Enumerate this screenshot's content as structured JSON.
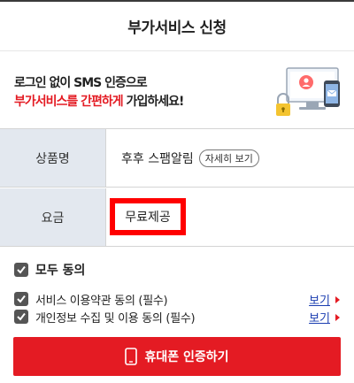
{
  "header": {
    "title": "부가서비스 신청"
  },
  "promo": {
    "line1": "로그인 없이 SMS 인증으로",
    "line2_highlight": "부가서비스를 간편하게",
    "line2_rest": " 가입하세요!",
    "illustration_icon": "computer-phone-lock-icon"
  },
  "info": {
    "rows": [
      {
        "label": "상품명",
        "value": "후후 스팸알림",
        "detail_button": "자세히 보기"
      },
      {
        "label": "요금",
        "value": "무료제공"
      }
    ]
  },
  "agreements": {
    "all_label": "모두 동의",
    "items": [
      {
        "label": "서비스 이용약관 동의 (필수)",
        "view_label": "보기"
      },
      {
        "label": "개인정보 수집 및 이용 동의 (필수)",
        "view_label": "보기"
      }
    ]
  },
  "cta": {
    "label": "휴대폰 인증하기",
    "icon": "phone-icon"
  },
  "colors": {
    "accent": "#e41b23",
    "label_bg": "#e3e8ef",
    "link": "#1a3db0",
    "highlight_box": "#ff0000"
  }
}
